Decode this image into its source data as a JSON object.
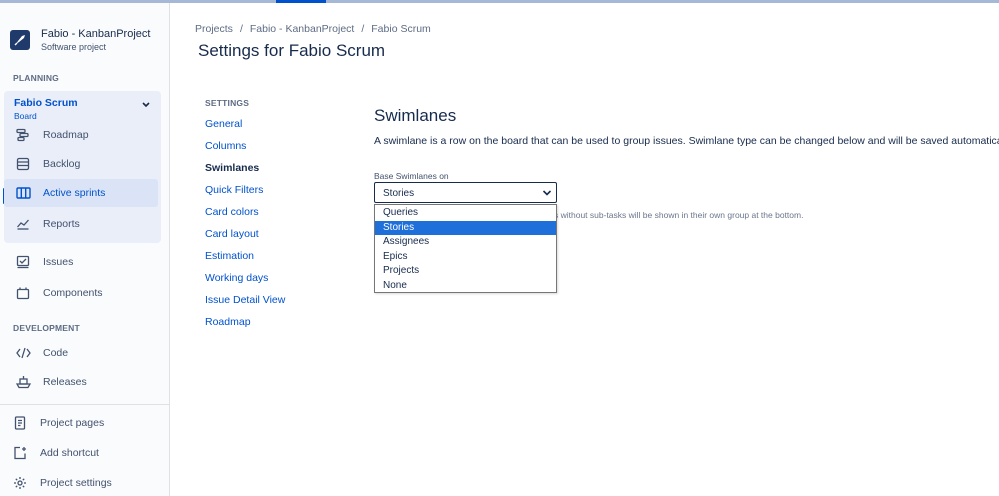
{
  "project": {
    "name": "Fabio - KanbanProject",
    "type": "Software project"
  },
  "sidebar": {
    "planning_label": "PLANNING",
    "board": {
      "name": "Fabio Scrum",
      "type": "Board"
    },
    "planning_items": [
      {
        "label": "Roadmap",
        "icon": "roadmap-icon"
      },
      {
        "label": "Backlog",
        "icon": "backlog-icon"
      },
      {
        "label": "Active sprints",
        "icon": "board-columns-icon"
      },
      {
        "label": "Reports",
        "icon": "reports-icon"
      }
    ],
    "other_items": [
      {
        "label": "Issues",
        "icon": "issues-icon"
      },
      {
        "label": "Components",
        "icon": "components-icon"
      }
    ],
    "development_label": "DEVELOPMENT",
    "development_items": [
      {
        "label": "Code",
        "icon": "code-icon"
      },
      {
        "label": "Releases",
        "icon": "releases-icon"
      }
    ],
    "footer_items": [
      {
        "label": "Project pages",
        "icon": "page-icon"
      },
      {
        "label": "Add shortcut",
        "icon": "add-shortcut-icon"
      },
      {
        "label": "Project settings",
        "icon": "gear-icon"
      }
    ]
  },
  "breadcrumb": [
    "Projects",
    "Fabio - KanbanProject",
    "Fabio Scrum"
  ],
  "breadcrumb_sep": "/",
  "page_title": "Settings for Fabio Scrum",
  "settings_nav": {
    "heading": "SETTINGS",
    "items": [
      "General",
      "Columns",
      "Swimlanes",
      "Quick Filters",
      "Card colors",
      "Card layout",
      "Estimation",
      "Working days",
      "Issue Detail View",
      "Roadmap"
    ],
    "current": "Swimlanes"
  },
  "swimlanes": {
    "title": "Swimlanes",
    "description": "A swimlane is a row on the board that can be used to group issues. Swimlane type can be changed below and will be saved automatically. L",
    "field_label": "Base Swimlanes on",
    "selected": "Stories",
    "options": [
      "Queries",
      "Stories",
      "Assignees",
      "Epics",
      "Projects",
      "None"
    ],
    "helper_text": "s without sub-tasks will be shown in their own group at the bottom."
  },
  "colors": {
    "accent": "#0052cc",
    "highlight": "#1e6fd9",
    "text": "#172b4d"
  }
}
